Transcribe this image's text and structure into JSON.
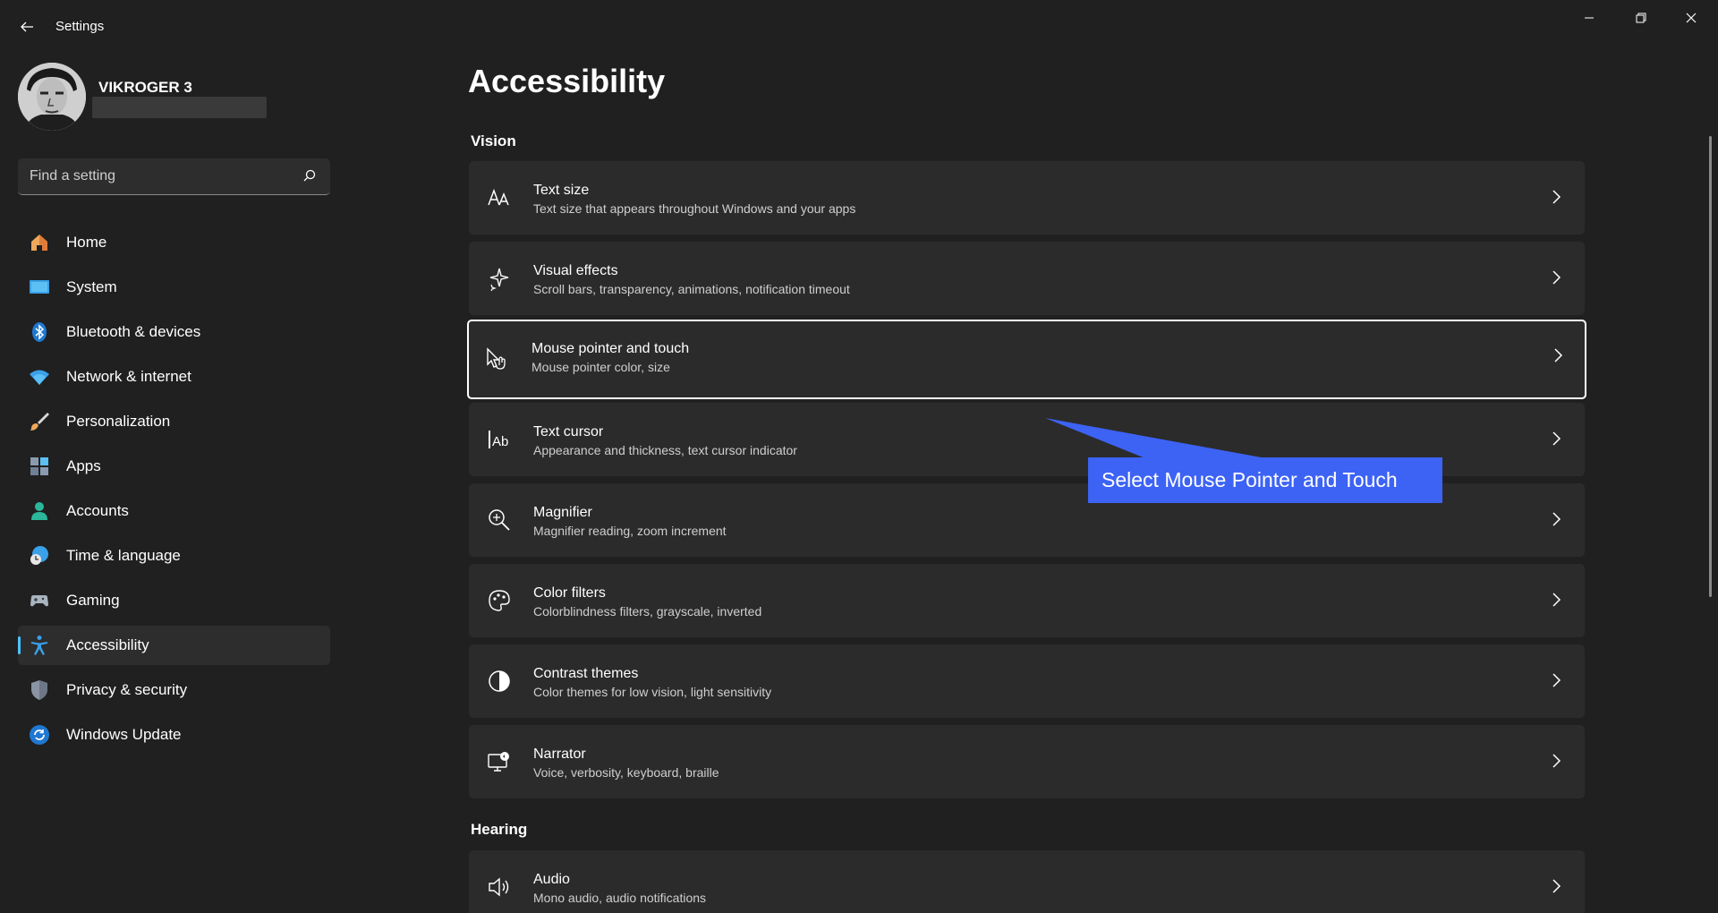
{
  "window": {
    "title": "Settings",
    "controls": [
      "minimize",
      "restore",
      "close"
    ]
  },
  "profile": {
    "name": "VIKROGER 3"
  },
  "search": {
    "placeholder": "Find a setting"
  },
  "sidebar": {
    "items": [
      {
        "label": "Home",
        "icon": "home-icon"
      },
      {
        "label": "System",
        "icon": "system-icon"
      },
      {
        "label": "Bluetooth & devices",
        "icon": "bluetooth-icon"
      },
      {
        "label": "Network & internet",
        "icon": "wifi-icon"
      },
      {
        "label": "Personalization",
        "icon": "brush-icon"
      },
      {
        "label": "Apps",
        "icon": "apps-icon"
      },
      {
        "label": "Accounts",
        "icon": "accounts-icon"
      },
      {
        "label": "Time & language",
        "icon": "globe-clock-icon"
      },
      {
        "label": "Gaming",
        "icon": "gamepad-icon"
      },
      {
        "label": "Accessibility",
        "icon": "accessibility-icon",
        "active": true
      },
      {
        "label": "Privacy & security",
        "icon": "shield-icon"
      },
      {
        "label": "Windows Update",
        "icon": "update-icon"
      }
    ]
  },
  "main": {
    "title": "Accessibility",
    "sections": {
      "vision": "Vision",
      "hearing": "Hearing"
    },
    "cards": [
      {
        "title": "Text size",
        "subtitle": "Text size that appears throughout Windows and your apps",
        "icon": "text-size-icon"
      },
      {
        "title": "Visual effects",
        "subtitle": "Scroll bars, transparency, animations, notification timeout",
        "icon": "sparkle-icon"
      },
      {
        "title": "Mouse pointer and touch",
        "subtitle": "Mouse pointer color, size",
        "icon": "pointer-touch-icon",
        "focused": true
      },
      {
        "title": "Text cursor",
        "subtitle": "Appearance and thickness, text cursor indicator",
        "icon": "text-cursor-icon"
      },
      {
        "title": "Magnifier",
        "subtitle": "Magnifier reading, zoom increment",
        "icon": "magnifier-icon"
      },
      {
        "title": "Color filters",
        "subtitle": "Colorblindness filters, grayscale, inverted",
        "icon": "palette-icon"
      },
      {
        "title": "Contrast themes",
        "subtitle": "Color themes for low vision, light sensitivity",
        "icon": "contrast-icon"
      },
      {
        "title": "Narrator",
        "subtitle": "Voice, verbosity, keyboard, braille",
        "icon": "narrator-icon"
      },
      {
        "title": "Audio",
        "subtitle": "Mono audio, audio notifications",
        "icon": "speaker-icon"
      }
    ]
  },
  "callout": {
    "text": "Select Mouse Pointer and Touch",
    "color": "#3d63f5"
  },
  "colors": {
    "background": "#202020",
    "card": "#2b2b2b",
    "accent": "#4cc2ff"
  }
}
